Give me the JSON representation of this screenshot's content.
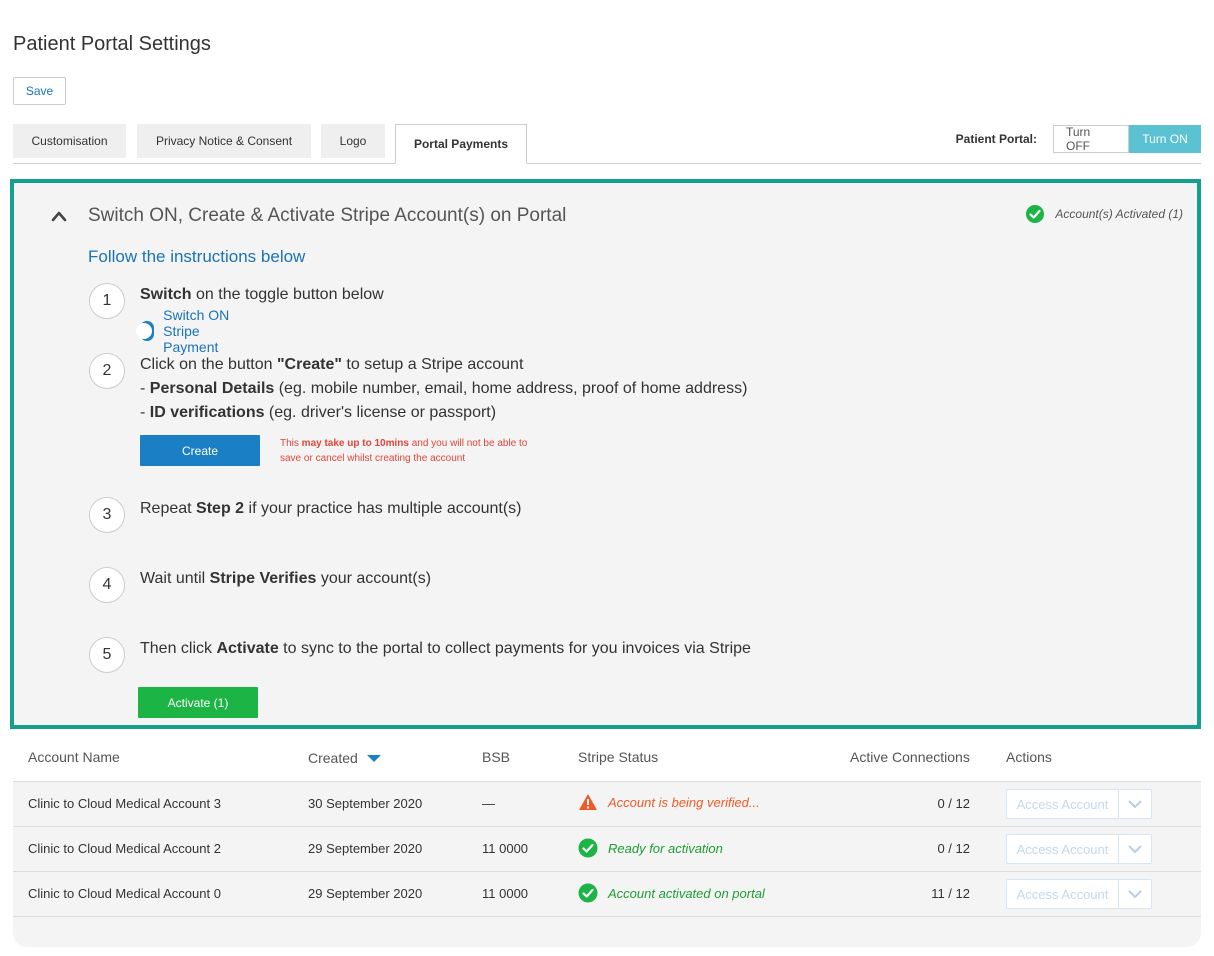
{
  "page": {
    "title": "Patient Portal Settings"
  },
  "toolbar": {
    "save_label": "Save"
  },
  "tabs": [
    {
      "label": "Customisation"
    },
    {
      "label": "Privacy Notice & Consent"
    },
    {
      "label": "Logo"
    },
    {
      "label": "Portal Payments",
      "active": true
    }
  ],
  "portal_toggle": {
    "label": "Patient Portal:",
    "off_label": "Turn OFF",
    "on_label": "Turn ON",
    "selected": "on"
  },
  "panel": {
    "title": "Switch ON, Create & Activate Stripe Account(s) on Portal",
    "activated_badge": "Account(s) Activated (1)",
    "instructions_heading": "Follow the instructions below",
    "steps": [
      {
        "number": "1",
        "bold": "Switch",
        "text": " on the toggle button below",
        "switch_label": "Switch ON Stripe Payment"
      },
      {
        "number": "2",
        "text_pre": "Click on the button ",
        "bold": "\"Create\"",
        "text_post": " to setup a Stripe account",
        "line2_pre": "- ",
        "line2_bold": "Personal Details",
        "line2_text": " (eg. mobile number, email, home address, proof of home address)",
        "line3_pre": "- ",
        "line3_bold": "ID verifications",
        "line3_text": " (eg. driver's license or passport)",
        "button_label": "Create",
        "warning_pre": "This ",
        "warning_bold": "may take up to 10mins",
        "warning_post": " and you will not be able to save or cancel whilst creating the account"
      },
      {
        "number": "3",
        "text_pre": "Repeat ",
        "bold": "Step 2",
        "text_post": " if your practice has multiple account(s)"
      },
      {
        "number": "4",
        "text_pre": "Wait until ",
        "bold": "Stripe Verifies",
        "text_post": " your account(s)"
      },
      {
        "number": "5",
        "text_pre": "Then click ",
        "bold": "Activate",
        "text_post": " to sync to the portal to collect payments for you invoices via Stripe",
        "button_label": "Activate (1)"
      }
    ]
  },
  "table": {
    "headers": {
      "account_name": "Account Name",
      "created": "Created",
      "bsb": "BSB",
      "stripe_status": "Stripe Status",
      "active_connections": "Active Connections",
      "actions": "Actions"
    },
    "rows": [
      {
        "account_name": "Clinic to Cloud Medical Account 3",
        "created": "30 September 2020",
        "bsb": "—",
        "status": "Account is being verified...",
        "status_type": "warning",
        "connections": "0 / 12",
        "action": "Access Account"
      },
      {
        "account_name": "Clinic to Cloud Medical Account 2",
        "created": "29 September 2020",
        "bsb": "11 0000",
        "status": "Ready for activation",
        "status_type": "success",
        "connections": "0 / 12",
        "action": "Access Account"
      },
      {
        "account_name": "Clinic to Cloud Medical Account 0",
        "created": "29 September 2020",
        "bsb": "11 0000",
        "status": "Account activated on portal",
        "status_type": "success",
        "connections": "11 / 12",
        "action": "Access Account"
      }
    ]
  },
  "colors": {
    "accent": "#14a08c",
    "primary": "#1a7fc4",
    "success": "#1db446",
    "warning": "#f05a28",
    "toggle_on": "#5bc2d3"
  }
}
